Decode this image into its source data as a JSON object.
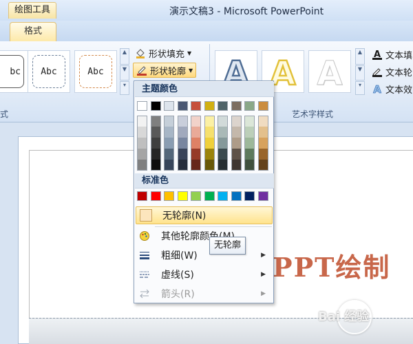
{
  "titlebar": {
    "contextual_tab": "绘图工具",
    "window_title": "演示文稿3 - Microsoft PowerPoint"
  },
  "tabs": {
    "format": "格式"
  },
  "ribbon": {
    "shape_styles": {
      "tile_text": "Abc",
      "group_label": "式",
      "first_tile_text": "bc"
    },
    "commands": {
      "shape_fill": "形状填充",
      "shape_outline": "形状轮廓"
    },
    "wordart": {
      "group_label": "艺术字样式",
      "glyph": "A",
      "text_fill": "文本填",
      "text_outline": "文本轮",
      "text_effects": "文本效"
    }
  },
  "menu": {
    "theme_colors_header": "主题颜色",
    "standard_colors_header": "标准色",
    "theme_top_row": [
      "#ffffff",
      "#000000",
      "#dde4ec",
      "#4b5873",
      "#c6503c",
      "#d1b012",
      "#4f6368",
      "#7c6e61",
      "#8aa888",
      "#cb8d3f"
    ],
    "theme_columns": [
      [
        "#f2f2f2",
        "#d8d8d8",
        "#bfbfbf",
        "#a5a5a5",
        "#7f7f7f"
      ],
      [
        "#7f7f7f",
        "#595959",
        "#3f3f3f",
        "#262626",
        "#0d0d0d"
      ],
      [
        "#c5cfd9",
        "#a7b6c6",
        "#8a9db2",
        "#54677a",
        "#37455a"
      ],
      [
        "#c9cedb",
        "#a1a9bd",
        "#7986a0",
        "#3a445a",
        "#262d3c"
      ],
      [
        "#f2d2c9",
        "#e9aa98",
        "#de8165",
        "#963b29",
        "#66261a"
      ],
      [
        "#fbf0a4",
        "#f6e06d",
        "#efd03b",
        "#9b840c",
        "#685808"
      ],
      [
        "#d1dad9",
        "#a9b9b7",
        "#85999a",
        "#3b4a4e",
        "#272f32"
      ],
      [
        "#dcd4cd",
        "#c4b8ab",
        "#ae9c89",
        "#5e5248",
        "#3e3630"
      ],
      [
        "#dbe6d8",
        "#bccfb9",
        "#9db89a",
        "#5e7a5c",
        "#3f503d"
      ],
      [
        "#f0dcc1",
        "#e3c08c",
        "#d7a25d",
        "#99652a",
        "#64421b"
      ]
    ],
    "standard_colors": [
      "#c00000",
      "#ff0000",
      "#ffc000",
      "#ffff00",
      "#92d050",
      "#00b050",
      "#00b0f0",
      "#0070c0",
      "#002060",
      "#7030a0"
    ],
    "no_outline": "无轮廓(N)",
    "more_colors": "其他轮廓颜色(M)...",
    "weight": "粗细(W)",
    "dashes": "虚线(S)",
    "arrows": "箭头(R)"
  },
  "tooltip": {
    "text": "无轮廓"
  },
  "slide": {
    "text": "PPT绘制",
    "watermark": "Bai 经验"
  },
  "colors": {
    "accent_hover": "#ffe38c",
    "slide_text": "#c8674a"
  }
}
